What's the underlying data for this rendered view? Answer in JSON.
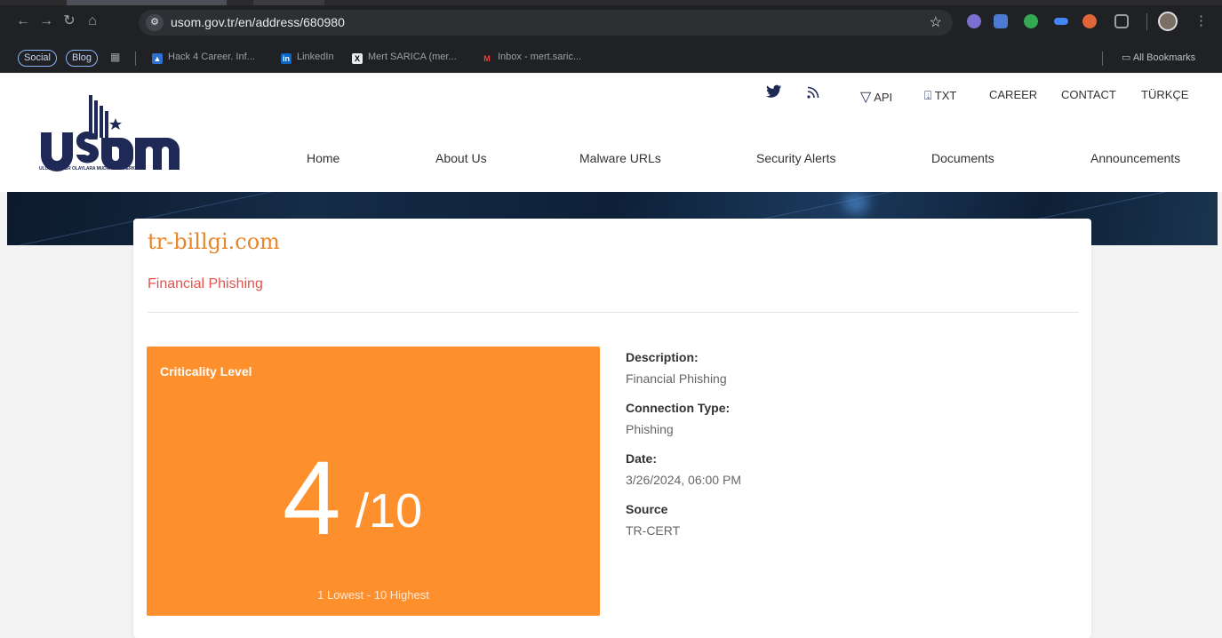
{
  "browser": {
    "url": "usom.gov.tr/en/address/680980",
    "bookmarks": {
      "chips": [
        "Social",
        "Blog"
      ],
      "items": [
        "Hack 4 Career. Inf...",
        "LinkedIn",
        "Mert SARICA (mer...",
        "Inbox - mert.saric..."
      ],
      "all_bookmarks": "All Bookmarks"
    }
  },
  "site": {
    "logo_text": "usom",
    "logo_caption": "ULUSAL SIBER OLAYLARA MUDAHALE MERKEZI",
    "top_links": {
      "api": "API",
      "txt": "TXT",
      "career": "CAREER",
      "contact": "CONTACT",
      "language": "TÜRKÇE"
    },
    "nav": [
      "Home",
      "About Us",
      "Malware URLs",
      "Security Alerts",
      "Documents",
      "Announcements"
    ]
  },
  "record": {
    "domain": "tr-billgi.com",
    "category": "Financial Phishing",
    "criticality": {
      "title": "Criticality Level",
      "value": "4",
      "denominator": "/10",
      "scale": "1 Lowest - 10 Highest"
    },
    "details": {
      "description_label": "Description:",
      "description": "Financial Phishing",
      "connection_type_label": "Connection Type:",
      "connection_type": "Phishing",
      "date_label": "Date:",
      "date": "3/26/2024, 06:00 PM",
      "source_label": "Source",
      "source": "TR-CERT"
    }
  },
  "colors": {
    "accent_orange": "#fd8f2d",
    "domain_orange": "#e8862a",
    "category_red": "#e05550",
    "navy": "#1e2a55"
  }
}
